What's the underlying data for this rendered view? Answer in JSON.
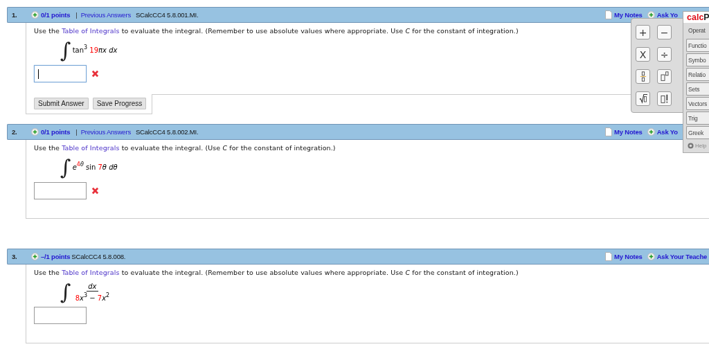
{
  "questions": [
    {
      "number": "1.",
      "points": "0/1 points",
      "separator": "|",
      "previous": "Previous Answers",
      "code": "SCalcCC4 5.8.001.MI.",
      "notes": "My Notes",
      "ask": "Ask Yo",
      "instruction": {
        "before": "Use the",
        "link": "Table of Integrals",
        "after": "to evaluate the integral. (Remember to use absolute values where appropriate. Use *C* for the constant of integration.)"
      },
      "integral": {
        "kind": "inline",
        "sign": "∫",
        "tokens": [
          {
            "text": "tan",
            "sup": false,
            "italic": false,
            "highlight": false
          },
          {
            "text": "3",
            "sup": true,
            "italic": false,
            "highlight": false
          },
          {
            "text": " 19",
            "sup": false,
            "italic": false,
            "highlight": true
          },
          {
            "text": "πx",
            "sup": false,
            "italic": true,
            "highlight": false
          },
          {
            "text": " dx",
            "sup": false,
            "italic": true,
            "highlight": false
          }
        ]
      },
      "answer": {
        "focused": true,
        "incorrect": true
      },
      "buttons": [
        "Submit Answer",
        "Save Progress"
      ]
    },
    {
      "number": "2.",
      "points": "0/1 points",
      "separator": "|",
      "previous": "Previous Answers",
      "code": "SCalcCC4 5.8.002.MI.",
      "notes": "My Notes",
      "ask": "Ask Yo",
      "instruction": {
        "before": "Use the",
        "link": "Table of Integrals",
        "after": "to evaluate the integral. (Use *C* for the constant of integration.)"
      },
      "integral": {
        "kind": "inline",
        "sign": "∫",
        "tokens": [
          {
            "text": "e",
            "sup": false,
            "italic": true,
            "highlight": false
          },
          {
            "text": "4",
            "sup": true,
            "italic": false,
            "highlight": true
          },
          {
            "text": "θ",
            "sup": true,
            "italic": true,
            "highlight": false
          },
          {
            "text": " sin ",
            "sup": false,
            "italic": false,
            "highlight": false
          },
          {
            "text": "7",
            "sup": false,
            "italic": false,
            "highlight": true
          },
          {
            "text": "θ",
            "sup": false,
            "italic": true,
            "highlight": false
          },
          {
            "text": " dθ",
            "sup": false,
            "italic": true,
            "highlight": false
          }
        ]
      },
      "answer": {
        "focused": false,
        "incorrect": true
      }
    },
    {
      "number": "3.",
      "points": "–/1 points",
      "code": "SCalcCC4 5.8.008.",
      "notes": "My Notes",
      "ask": "Ask Your Teache",
      "instruction": {
        "before": "Use the",
        "link": "Table of Integrals",
        "after": "to evaluate the integral. (Remember to use absolute values where appropriate. Use *C* for the constant of integration.)"
      },
      "integral": {
        "kind": "fraction",
        "sign": "∫",
        "numerator": [
          {
            "text": "dx",
            "sup": false,
            "italic": true,
            "highlight": false
          }
        ],
        "denominator": [
          {
            "text": "8",
            "sup": false,
            "italic": false,
            "highlight": true
          },
          {
            "text": "x",
            "sup": false,
            "italic": true,
            "highlight": false
          },
          {
            "text": "3",
            "sup": true,
            "italic": false,
            "highlight": false
          },
          {
            "text": " − ",
            "sup": false,
            "highlight": false
          },
          {
            "text": "7",
            "sup": false,
            "italic": false,
            "highlight": true
          },
          {
            "text": "x",
            "sup": false,
            "italic": true,
            "highlight": false
          },
          {
            "text": "2",
            "sup": true,
            "italic": false,
            "highlight": false
          }
        ]
      },
      "answer": {
        "focused": false
      }
    }
  ],
  "palette": {
    "brand": "calc",
    "brand_rest": "P",
    "keys": [
      {
        "kind": "text",
        "text": "+"
      },
      {
        "kind": "text",
        "text": "−"
      },
      {
        "kind": "text",
        "text": "X"
      },
      {
        "kind": "text",
        "text": "÷"
      },
      {
        "kind": "fraction"
      },
      {
        "kind": "power"
      },
      {
        "kind": "root"
      },
      {
        "kind": "factorial"
      }
    ],
    "tabs": [
      {
        "label": "Operat",
        "selected": true
      },
      {
        "label": "Functio",
        "selected": false
      },
      {
        "label": "Symbo",
        "selected": false
      },
      {
        "label": "Relatio",
        "selected": false
      },
      {
        "label": "Sets",
        "selected": false
      },
      {
        "label": "Vectors",
        "selected": false
      },
      {
        "label": "Trig",
        "selected": false
      },
      {
        "label": "Greek",
        "selected": false
      }
    ],
    "help": "Help"
  }
}
